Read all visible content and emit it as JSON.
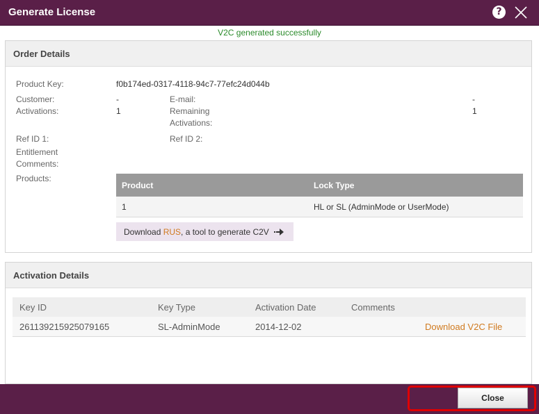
{
  "dialog": {
    "title": "Generate License",
    "help_icon": "?",
    "success_message": "V2C generated successfully"
  },
  "order_details": {
    "heading": "Order Details",
    "product_key_label": "Product Key:",
    "product_key": "f0b174ed-0317-4118-94c7-77efc24d044b",
    "customer_label": "Customer:",
    "customer": "-",
    "email_label": "E-mail:",
    "email": "-",
    "activations_label": "Activations:",
    "activations": "1",
    "remaining_label_1": "Remaining",
    "remaining_label_2": "Activations:",
    "remaining": "1",
    "ref_id_1_label": "Ref ID 1:",
    "ref_id_2_label": "Ref ID 2:",
    "entitlement_comments_label_1": "Entitlement",
    "entitlement_comments_label_2": "Comments:",
    "products_label": "Products:",
    "products_table": {
      "headers": [
        "Product",
        "Lock Type"
      ],
      "rows": [
        [
          "1",
          "HL or SL (AdminMode or UserMode)"
        ]
      ]
    },
    "download_rus": {
      "prefix": "Download ",
      "link": "RUS",
      "suffix": ", a tool to generate C2V"
    }
  },
  "activation_details": {
    "heading": "Activation Details",
    "headers": [
      "Key ID",
      "Key Type",
      "Activation Date",
      "Comments",
      ""
    ],
    "rows": [
      {
        "key_id": "261139215925079165",
        "key_type": "SL-AdminMode",
        "activation_date": "2014-12-02",
        "comments": "",
        "action": "Download V2C File"
      }
    ]
  },
  "footer": {
    "close_label": "Close",
    "highlight_color": "#e00000"
  },
  "colors": {
    "header_purple": "#5a1f48",
    "link_orange": "#d07a1f",
    "success_green": "#2a8a2a"
  },
  "icons": {
    "help": "question-circle-icon",
    "close": "close-x-icon",
    "arrow": "arrow-right-icon"
  }
}
